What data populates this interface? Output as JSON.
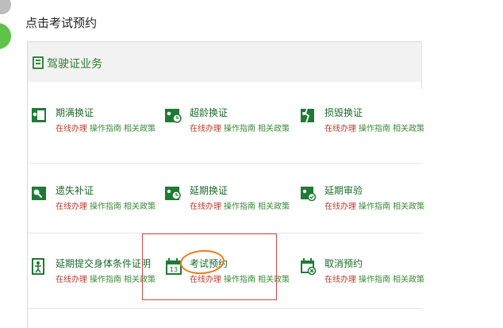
{
  "instruction": "点击考试预约",
  "panel": {
    "title": "驾驶证业务"
  },
  "links": {
    "online": "在线办理",
    "guide": "操作指南",
    "policy": "相关政策"
  },
  "services": [
    {
      "title": "期满换证",
      "icon": "license-renew-icon"
    },
    {
      "title": "超龄换证",
      "icon": "overage-renew-icon"
    },
    {
      "title": "损毁换证",
      "icon": "damaged-replace-icon"
    },
    {
      "title": "遗失补证",
      "icon": "lost-reissue-icon"
    },
    {
      "title": "延期换证",
      "icon": "extension-renew-icon"
    },
    {
      "title": "延期审验",
      "icon": "extension-review-icon"
    },
    {
      "title": "延期提交身体条件证明",
      "icon": "health-certificate-icon"
    },
    {
      "title": "考试预约",
      "icon": "calendar-icon",
      "calendar_day": "13"
    },
    {
      "title": "取消预约",
      "icon": "cancel-booking-icon"
    }
  ],
  "colors": {
    "accent": "#2e7d33",
    "online_link": "#c0392b",
    "highlight_box": "#d8474b",
    "annotation": "#ee7b1e"
  }
}
